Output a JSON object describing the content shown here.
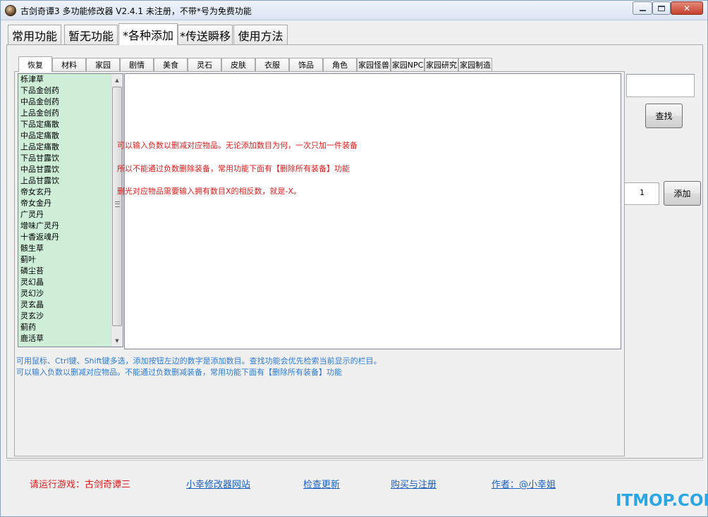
{
  "window": {
    "title": "古剑奇谭3 多功能修改器  V2.4.1 未注册，不带*号为免费功能",
    "close_glyph": "✕"
  },
  "main_tabs": [
    {
      "label": "常用功能"
    },
    {
      "label": "暂无功能"
    },
    {
      "label": "*各种添加"
    },
    {
      "label": "*传送瞬移"
    },
    {
      "label": "使用方法"
    }
  ],
  "sub_tabs": [
    {
      "label": "恢复"
    },
    {
      "label": "材料"
    },
    {
      "label": "家园"
    },
    {
      "label": "剧情"
    },
    {
      "label": "美食"
    },
    {
      "label": "灵石"
    },
    {
      "label": "皮肤"
    },
    {
      "label": "衣服"
    },
    {
      "label": "饰品"
    },
    {
      "label": "角色"
    },
    {
      "label": "家园怪兽"
    },
    {
      "label": "家园NPC"
    },
    {
      "label": "家园研究"
    },
    {
      "label": "家园制造"
    }
  ],
  "items": [
    "栎津草",
    "下品金创药",
    "中品金创药",
    "上品金创药",
    "下品定痛散",
    "中品定痛散",
    "上品定痛散",
    "下品甘露饮",
    "中品甘露饮",
    "上品甘露饮",
    "帝女玄丹",
    "帝女金丹",
    "广灵丹",
    "增味广灵丹",
    "十香返魂丹",
    "骸生草",
    "蓟叶",
    "磷尘苔",
    "灵幻晶",
    "灵幻沙",
    "灵玄晶",
    "灵玄沙",
    "蓟药",
    "鹿活草"
  ],
  "red_messages": [
    "可以输入负数以删减对应物品。无论添加数目为何，一次只加一件装备",
    "所以不能通过负数删除装备，常用功能下面有【删除所有装备】功能",
    "删光对应物品需要输入拥有数目X的相反数，就是-X。"
  ],
  "search": {
    "button_label": "查找",
    "value": ""
  },
  "quantity": {
    "value": "1"
  },
  "add_button_label": "添加",
  "blue_messages": [
    "可用鼠标、Ctrl键、Shift键多选，添加按钮左边的数字是添加数目。查找功能会优先检索当前显示的栏目。",
    "可以输入负数以删减对应物品。不能通过负数删减装备，常用功能下面有【删除所有装备】功能"
  ],
  "footer": {
    "status": "请运行游戏：古剑奇谭三",
    "links": [
      "小幸修改器网站",
      "检查更新",
      "购买与注册",
      "作者：@小幸姐"
    ]
  },
  "watermark": "ITMOP.COM",
  "colors": {
    "list_bg": "#cfeed8",
    "red_text": "#e01c1c",
    "blue_text": "#2d7bd6",
    "link": "#1a5fc4",
    "watermark": "#2aa6e2"
  }
}
